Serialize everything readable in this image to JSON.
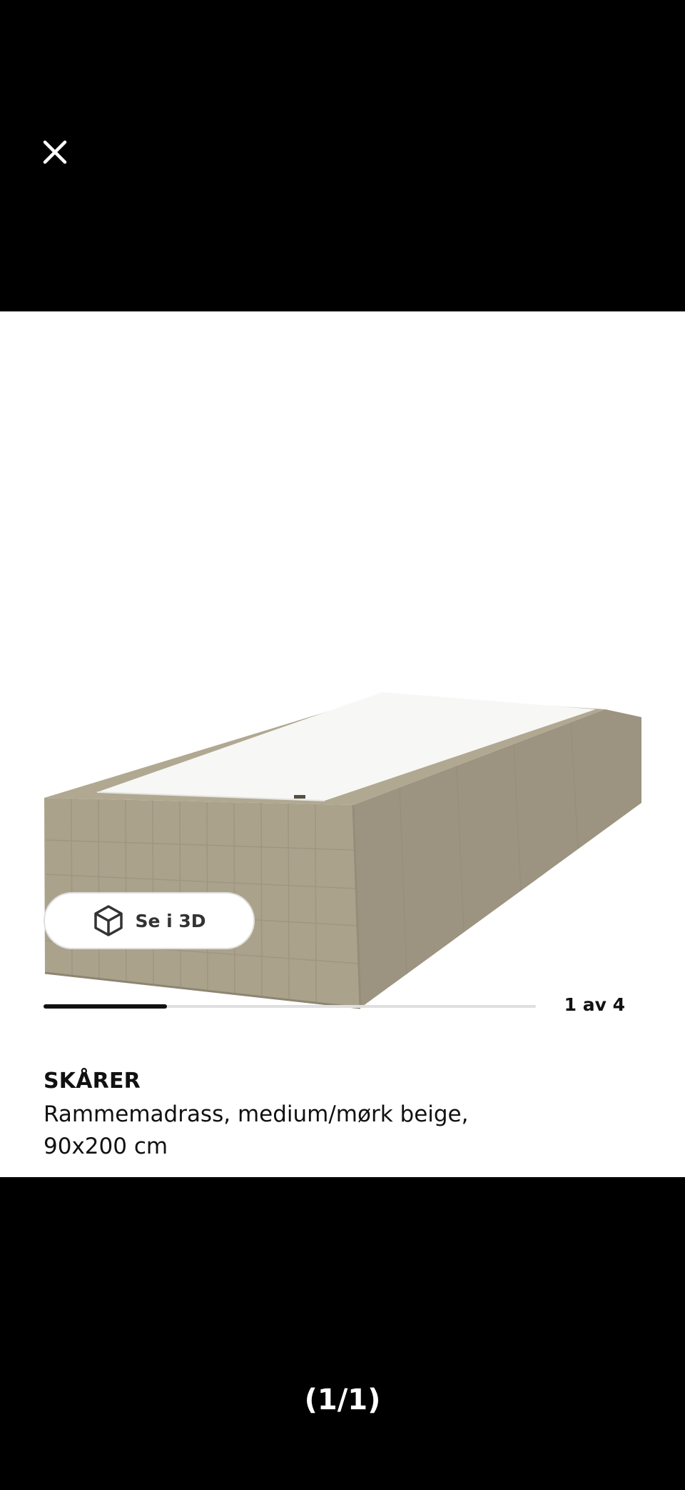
{
  "viewer": {
    "close_icon": "close-icon",
    "page_indicator": "(1/1)"
  },
  "product": {
    "image_alt": "SKÅRER Rammemadrass, medium/mørk beige, 90x200 cm",
    "view_3d": {
      "label": "Se i 3D",
      "icon": "cube-icon"
    },
    "carousel": {
      "counter": "1 av 4",
      "progress_fraction": 0.25
    },
    "name": "SKÅRER",
    "description": "Rammemadrass, medium/mørk beige, 90x200 cm"
  },
  "colors": {
    "background": "#000000",
    "card": "#ffffff",
    "text": "#111111",
    "button_border": "#dfdfdf",
    "fabric": "#a9a089",
    "mattress_top": "#ffffff"
  }
}
